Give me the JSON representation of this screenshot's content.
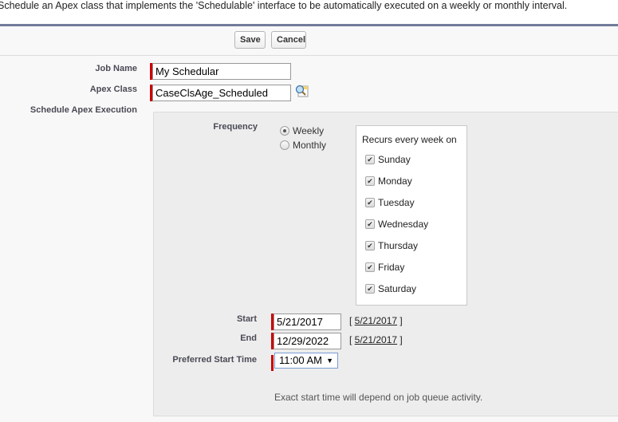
{
  "intro_text": "Schedule an Apex class that implements the 'Schedulable' interface to be automatically executed on a weekly or monthly interval.",
  "toolbar": {
    "save_label": "Save",
    "cancel_label": "Cancel"
  },
  "fields": {
    "job_name": {
      "label": "Job Name",
      "value": "My Schedular"
    },
    "apex_class": {
      "label": "Apex Class",
      "value": "CaseClsAge_Scheduled",
      "lookup_icon": "lookup-magnifier-icon"
    },
    "schedule_label": "Schedule Apex Execution"
  },
  "frequency": {
    "label": "Frequency",
    "options": [
      {
        "label": "Weekly",
        "checked": true
      },
      {
        "label": "Monthly",
        "checked": false
      }
    ]
  },
  "recurs": {
    "title": "Recurs every week on",
    "days": [
      {
        "label": "Sunday",
        "checked": true
      },
      {
        "label": "Monday",
        "checked": true
      },
      {
        "label": "Tuesday",
        "checked": true
      },
      {
        "label": "Wednesday",
        "checked": true
      },
      {
        "label": "Thursday",
        "checked": true
      },
      {
        "label": "Friday",
        "checked": true
      },
      {
        "label": "Saturday",
        "checked": true
      }
    ]
  },
  "dates": {
    "start": {
      "label": "Start",
      "value": "5/21/2017",
      "today_link": "5/21/2017"
    },
    "end": {
      "label": "End",
      "value": "12/29/2022",
      "today_link": "5/21/2017"
    }
  },
  "preferred_time": {
    "label": "Preferred Start Time",
    "value": "11:00 AM"
  },
  "note": "Exact start time will depend on job queue activity.",
  "colors": {
    "required": "#cc0000",
    "header_bar": "#737b9a"
  }
}
